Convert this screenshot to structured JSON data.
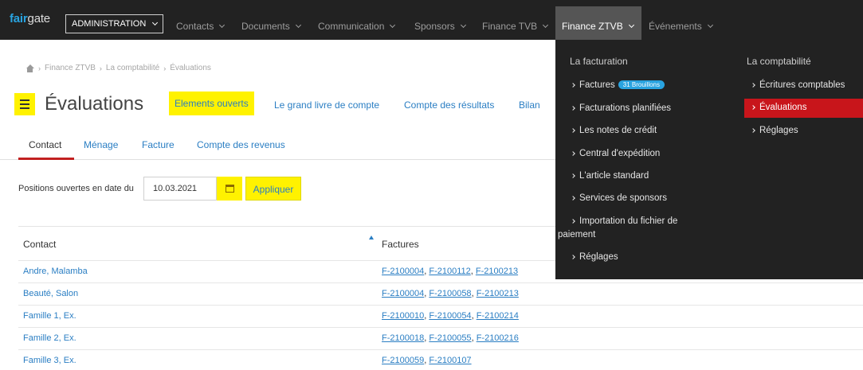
{
  "topbar": {
    "logo_accent": "fair",
    "logo_rest": "gate",
    "admin_label": "ADMINISTRATION",
    "nav": [
      {
        "label": "Contacts"
      },
      {
        "label": "Documents"
      },
      {
        "label": "Communication"
      },
      {
        "label": "Sponsors"
      },
      {
        "label": "Finance TVB"
      },
      {
        "label": "Finance ZTVB"
      },
      {
        "label": "Événements"
      }
    ]
  },
  "breadcrumb": [
    "Finance ZTVB",
    "La comptabilité",
    "Évaluations"
  ],
  "page": {
    "title": "Évaluations",
    "tabs": [
      {
        "label": "Elements ouverts"
      },
      {
        "label": "Le grand livre de compte"
      },
      {
        "label": "Compte des résultats"
      },
      {
        "label": "Bilan"
      }
    ],
    "subtabs": [
      {
        "label": "Contact"
      },
      {
        "label": "Ménage"
      },
      {
        "label": "Facture"
      },
      {
        "label": "Compte des revenus"
      }
    ]
  },
  "form": {
    "label": "Positions ouvertes en date du",
    "date_value": "10.03.2021",
    "apply_label": "Appliquer"
  },
  "table": {
    "headers": [
      "Contact",
      "Factures"
    ],
    "rows": [
      {
        "contact": "Andre, Malamba",
        "factures": [
          "F-2100004",
          "F-2100112",
          "F-2100213"
        ]
      },
      {
        "contact": "Beauté, Salon",
        "factures": [
          "F-2100004",
          "F-2100058",
          "F-2100213"
        ]
      },
      {
        "contact": "Famille 1, Ex.",
        "factures": [
          "F-2100010",
          "F-2100054",
          "F-2100214"
        ]
      },
      {
        "contact": "Famille 2, Ex.",
        "factures": [
          "F-2100018",
          "F-2100055",
          "F-2100216"
        ]
      },
      {
        "contact": "Famille 3, Ex.",
        "factures": [
          "F-2100059",
          "F-2100107"
        ]
      }
    ]
  },
  "dropdown": {
    "col1_title": "La facturation",
    "col1_items": [
      "Factures",
      "Facturations planifiées",
      "Les notes de crédit",
      "Central d'expédition",
      "L'article standard",
      "Services de sponsors",
      "Importation du fichier de",
      "paiement",
      "Réglages"
    ],
    "factures_badge": "31 Brouillons",
    "col2_title": "La comptabilité",
    "col2_items": [
      "Écritures comptables",
      "Évaluations",
      "Réglages"
    ]
  },
  "colors": {
    "navbar": "#222222",
    "link": "#2a7ec3",
    "highlight": "#fff200",
    "active_menu": "#c8151b",
    "badge": "#29a3e0"
  }
}
